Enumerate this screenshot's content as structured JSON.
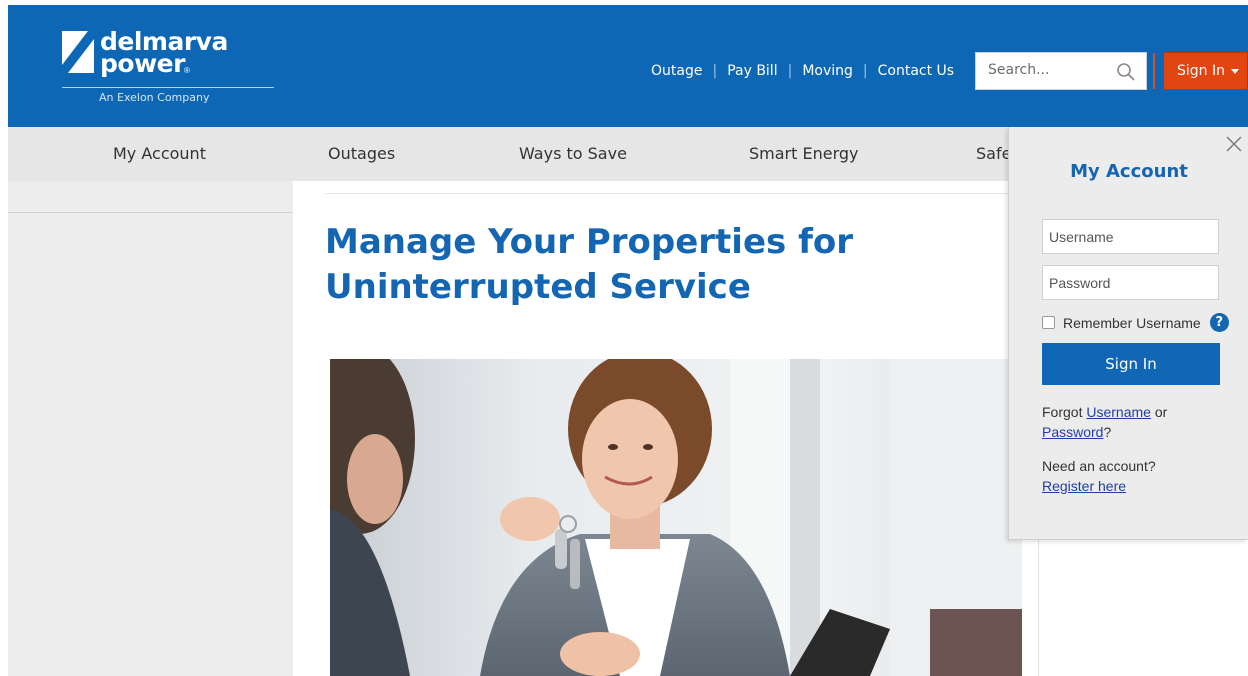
{
  "brand": {
    "name_line1": "delmarva",
    "name_line2": "power",
    "registered_mark": "®",
    "tagline": "An Exelon Company"
  },
  "utility_nav": {
    "items": [
      "Outage",
      "Pay Bill",
      "Moving",
      "Contact Us"
    ],
    "separator": "|"
  },
  "search": {
    "placeholder": "Search...",
    "icon": "search-icon"
  },
  "signin_button": {
    "label": "Sign In",
    "icon": "caret-down-icon"
  },
  "main_nav": {
    "items": [
      "My Account",
      "Outages",
      "Ways to Save",
      "Smart Energy",
      "Safe"
    ]
  },
  "page": {
    "heading": "Manage Your Properties for Uninterrupted Service"
  },
  "login_panel": {
    "title": "My Account",
    "username_placeholder": "Username",
    "password_placeholder": "Password",
    "remember_label": "Remember Username",
    "help_glyph": "?",
    "submit_label": "Sign In",
    "forgot_prefix": "Forgot",
    "forgot_username_link": "Username",
    "forgot_or": "or",
    "forgot_password_link": "Password",
    "forgot_suffix": "?",
    "need_account": "Need an account?",
    "register_link": "Register here",
    "close_icon": "close-icon"
  },
  "colors": {
    "header_blue": "#0d67b5",
    "accent_orange": "#e2450f",
    "heading_blue": "#1465b2",
    "nav_gray": "#e6e6e6",
    "link_blue": "#1f3fa6"
  }
}
